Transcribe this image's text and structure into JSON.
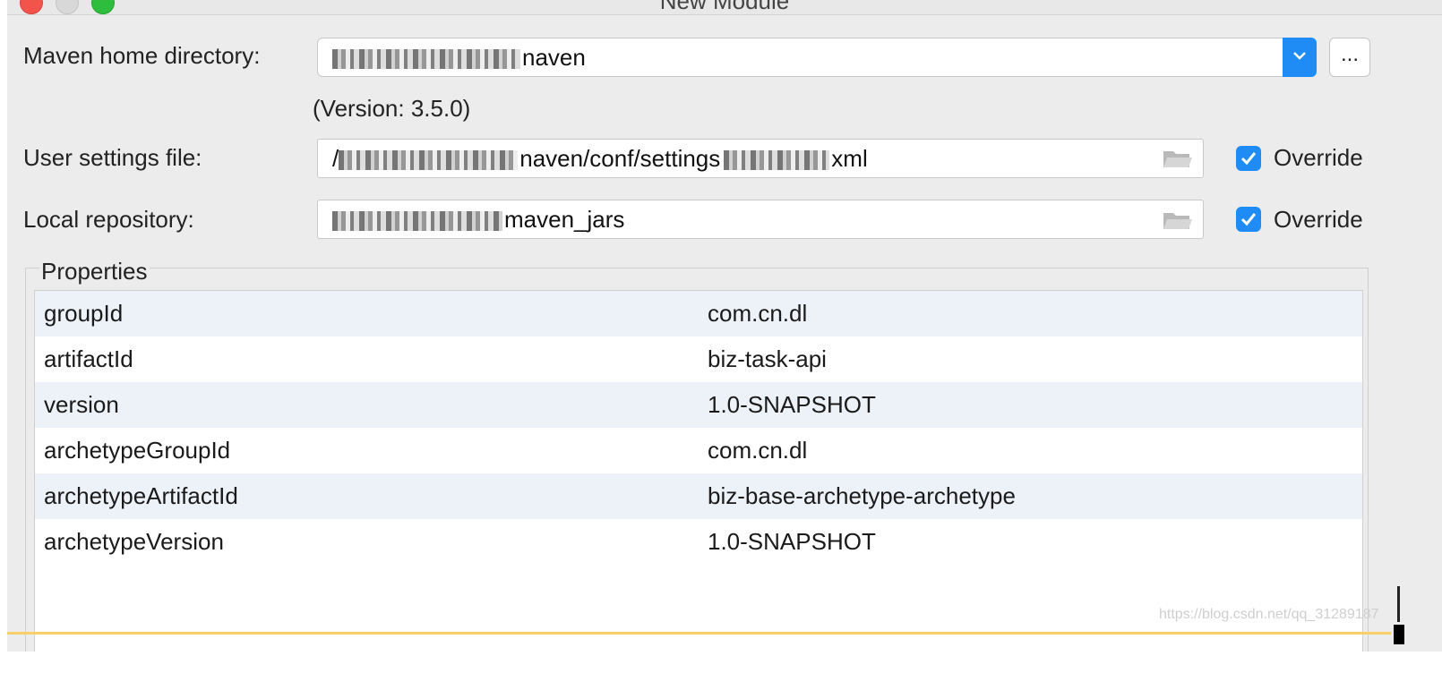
{
  "window": {
    "title": "New Module"
  },
  "maven_home": {
    "label": "Maven home directory:",
    "value_visible": "naven",
    "version": "(Version: 3.5.0)",
    "browse_label": "..."
  },
  "user_settings": {
    "label": "User settings file:",
    "value_visible_prefix": "/",
    "value_visible": "naven/conf/settings",
    "value_visible_suffix": "xml",
    "override_label": "Override",
    "override_checked": true
  },
  "local_repo": {
    "label": "Local repository:",
    "value_visible": "maven_jars",
    "override_label": "Override",
    "override_checked": true
  },
  "properties": {
    "legend": "Properties",
    "rows": [
      {
        "key": "groupId",
        "value": "com.cn.dl"
      },
      {
        "key": "artifactId",
        "value": "biz-task-api"
      },
      {
        "key": "version",
        "value": "1.0-SNAPSHOT"
      },
      {
        "key": "archetypeGroupId",
        "value": "com.cn.dl"
      },
      {
        "key": "archetypeArtifactId",
        "value": "biz-base-archetype-archetype"
      },
      {
        "key": "archetypeVersion",
        "value": "1.0-SNAPSHOT"
      }
    ]
  },
  "watermark": "https://blog.csdn.net/qq_31289187",
  "colors": {
    "accent": "#1f8cf6",
    "dialog_bg": "#ececec",
    "row_alt": "#edf2f9"
  }
}
